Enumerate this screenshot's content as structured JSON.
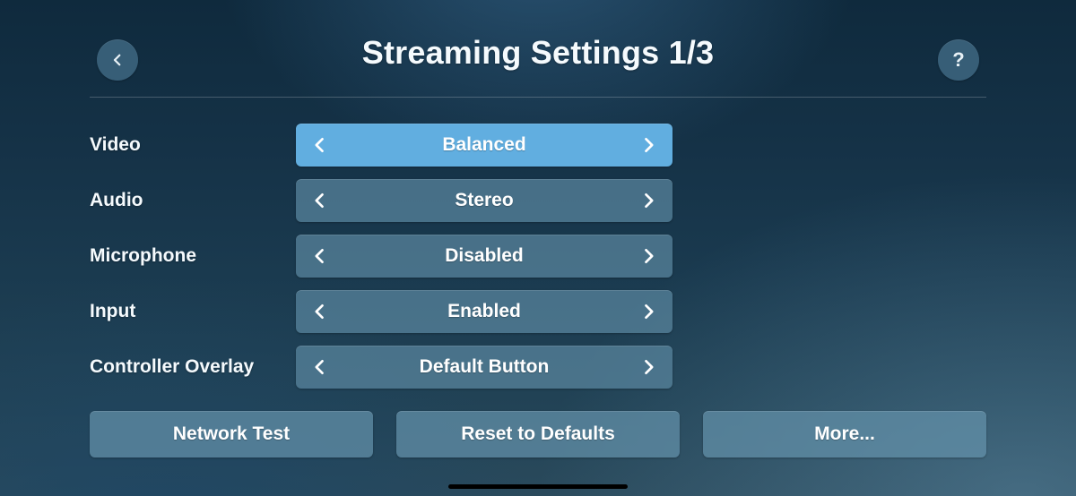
{
  "header": {
    "title": "Streaming Settings 1/3",
    "back_icon": "chevron-left",
    "help_label": "?"
  },
  "settings": {
    "video": {
      "label": "Video",
      "value": "Balanced",
      "highlight": true
    },
    "audio": {
      "label": "Audio",
      "value": "Stereo",
      "highlight": false
    },
    "microphone": {
      "label": "Microphone",
      "value": "Disabled",
      "highlight": false
    },
    "input": {
      "label": "Input",
      "value": "Enabled",
      "highlight": false
    },
    "controller_overlay": {
      "label": "Controller Overlay",
      "value": "Default Button",
      "highlight": false
    }
  },
  "footer": {
    "network_test": "Network Test",
    "reset": "Reset to Defaults",
    "more": "More..."
  },
  "colors": {
    "highlight": "#61aee0",
    "panel": "#5a8aa3"
  }
}
